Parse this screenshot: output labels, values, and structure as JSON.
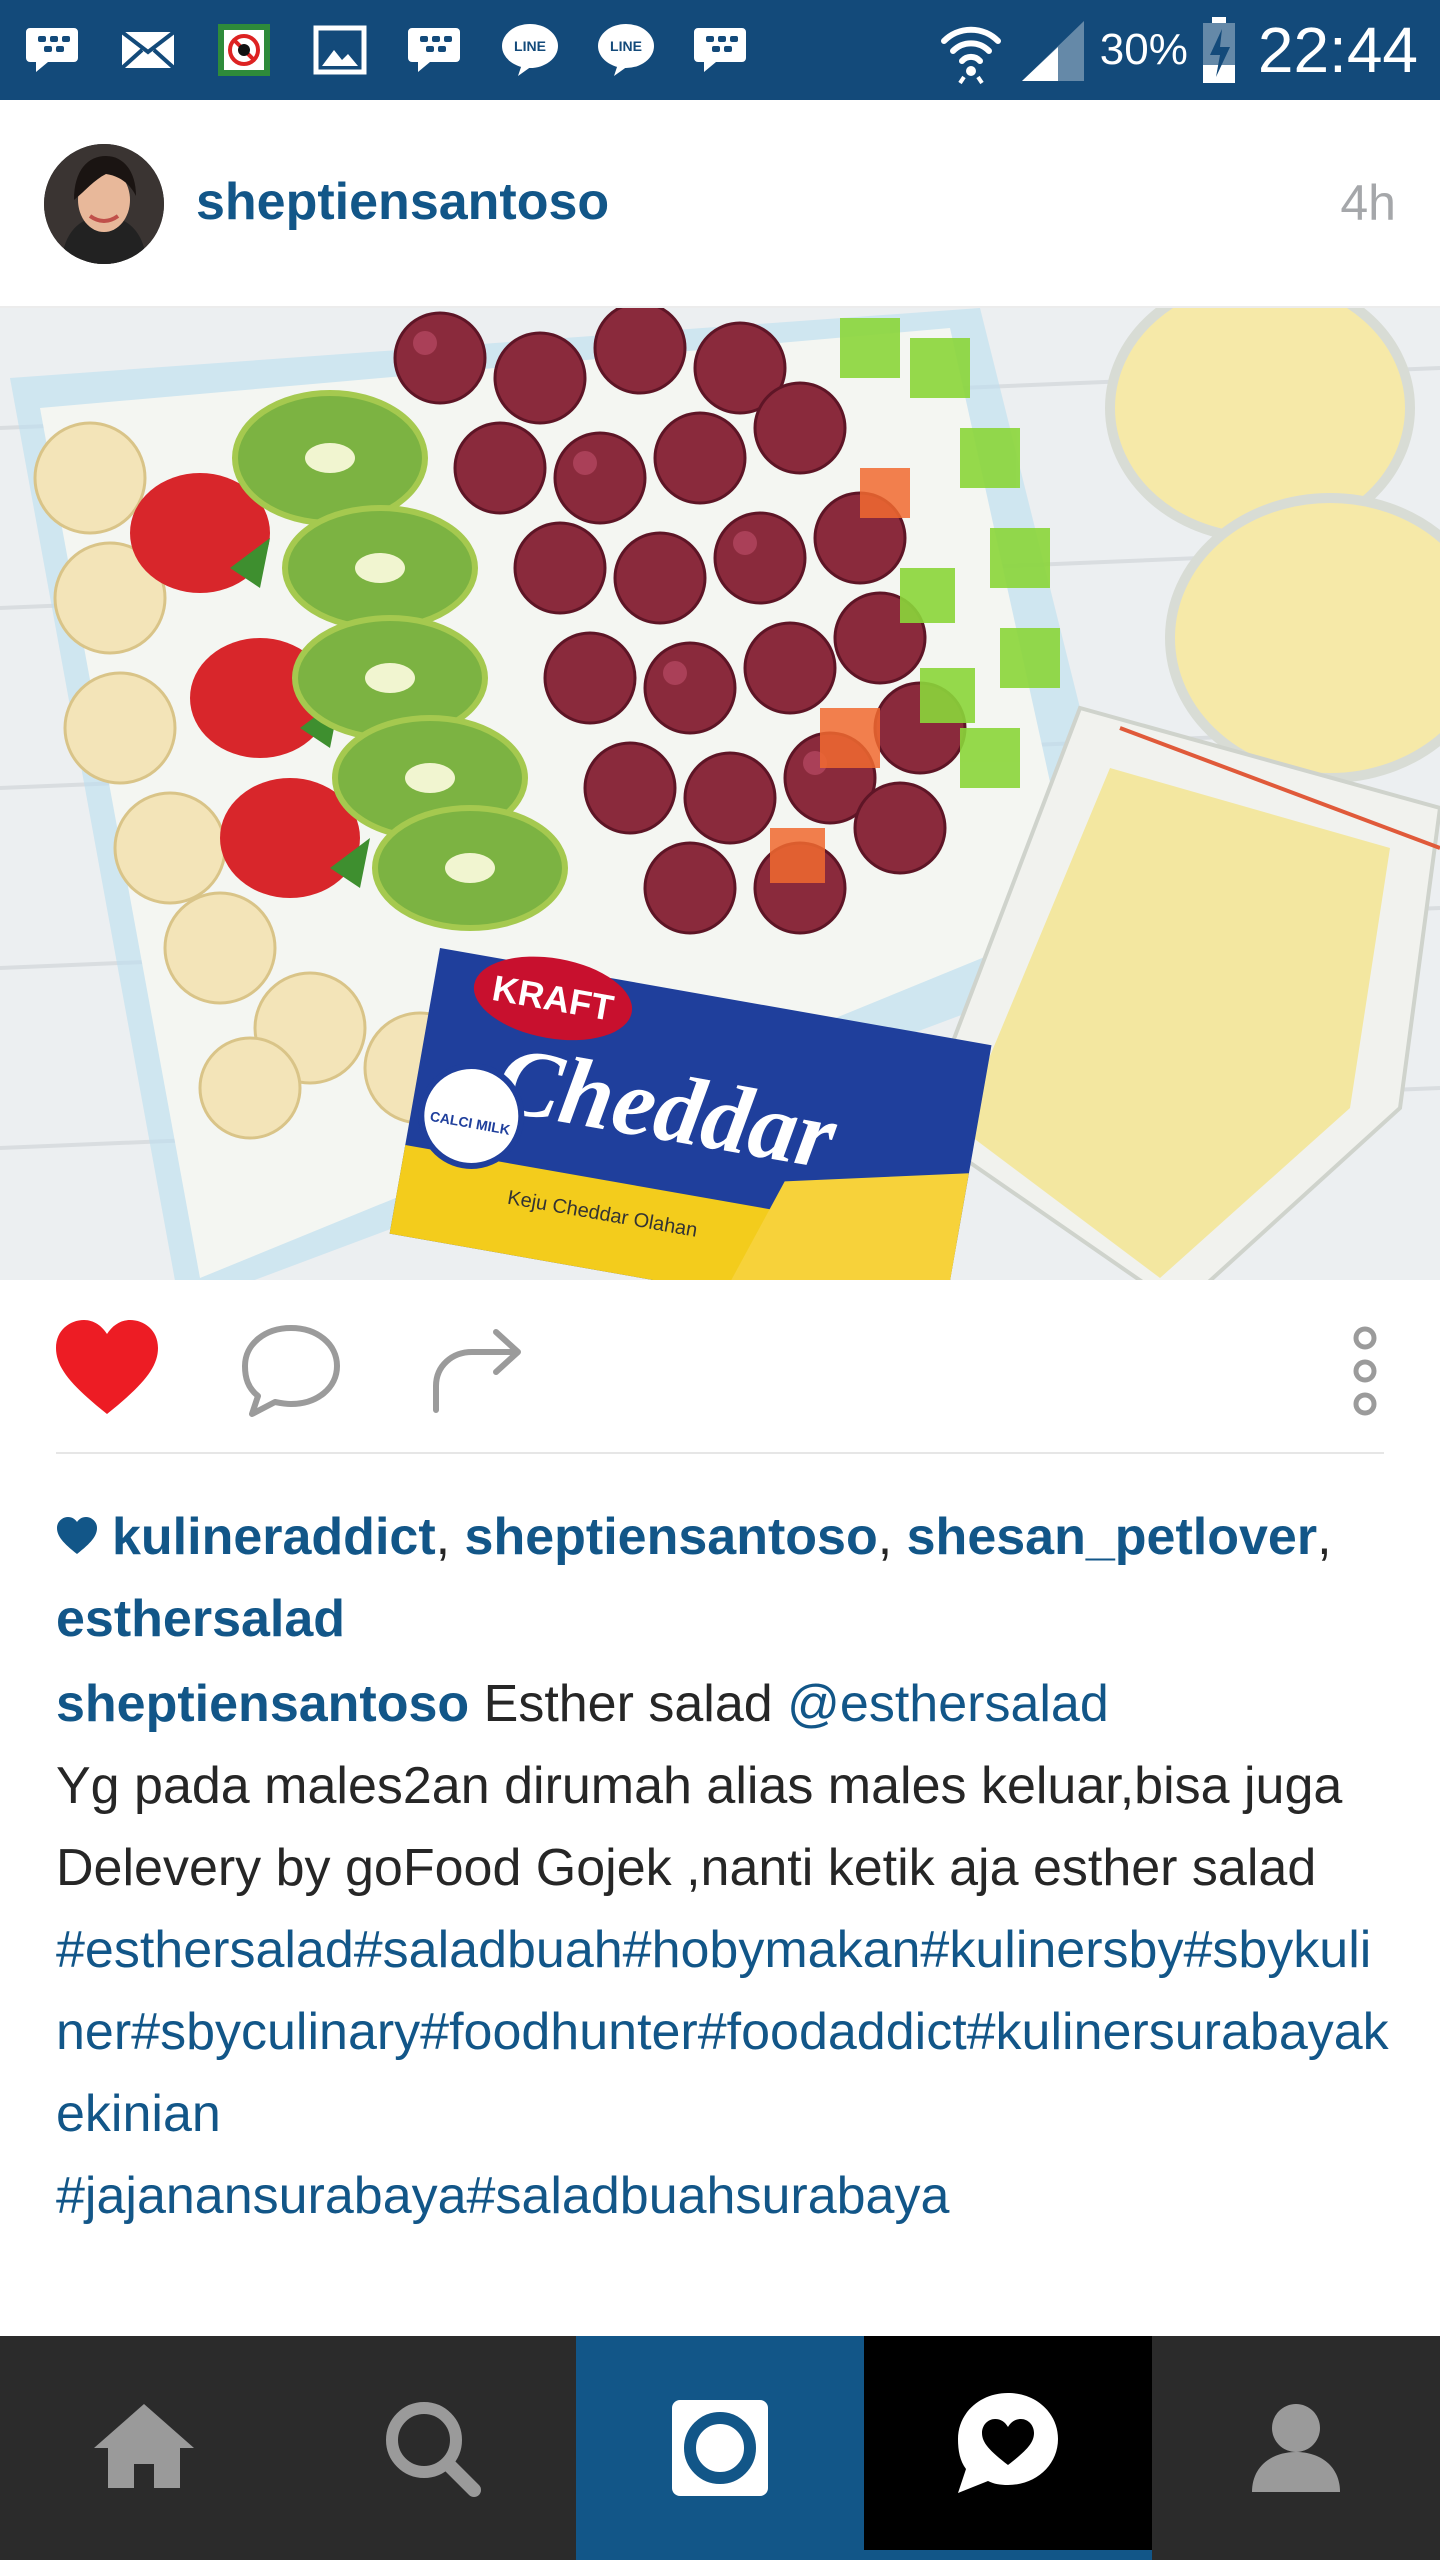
{
  "status_bar": {
    "notification_icons": [
      "bbm-icon",
      "mail-icon",
      "app-icon",
      "gallery-icon",
      "bbm-icon",
      "line-icon",
      "line-icon",
      "bbm-icon"
    ],
    "line_label": "LINE",
    "battery_percent": "30%",
    "battery_level": 0.3,
    "clock": "22:44"
  },
  "post": {
    "username": "sheptiensantoso",
    "time_ago": "4h",
    "liked": true,
    "photo": {
      "brand_text": "KRAFT",
      "product_text": "Cheddar",
      "sub_text": "Keju Cheddar Olahan",
      "badge_text": "CALCI MILK"
    },
    "likes": {
      "users": [
        "kulineraddict",
        "sheptiensantoso",
        "shesan_petlover",
        "esthersalad"
      ],
      "separator": ", "
    },
    "caption": {
      "username": "sheptiensantoso",
      "text_1": " Esther salad ",
      "mention": "@esthersalad",
      "body": "Yg pada males2an dirumah alias males keluar,bisa juga Delevery by goFood Gojek ,nanti ketik aja esther salad",
      "hashtags_1": "#esthersalad#saladbuah#hobymakan#kulinersby#sbykuliner#sbyculinary#foodhunter#foodaddict#kulinersurabayakekinian",
      "hashtags_2": "#jajanansurabaya#saladbuahsurabaya"
    }
  },
  "colors": {
    "brand_blue": "#125688",
    "status_bar": "#134a7a",
    "like_red": "#ed1c24",
    "nav_bg": "#2b2b2b"
  },
  "bottom_nav": {
    "items": [
      "home-icon",
      "search-icon",
      "camera-icon",
      "activity-icon",
      "profile-icon"
    ],
    "active": "activity-icon"
  }
}
